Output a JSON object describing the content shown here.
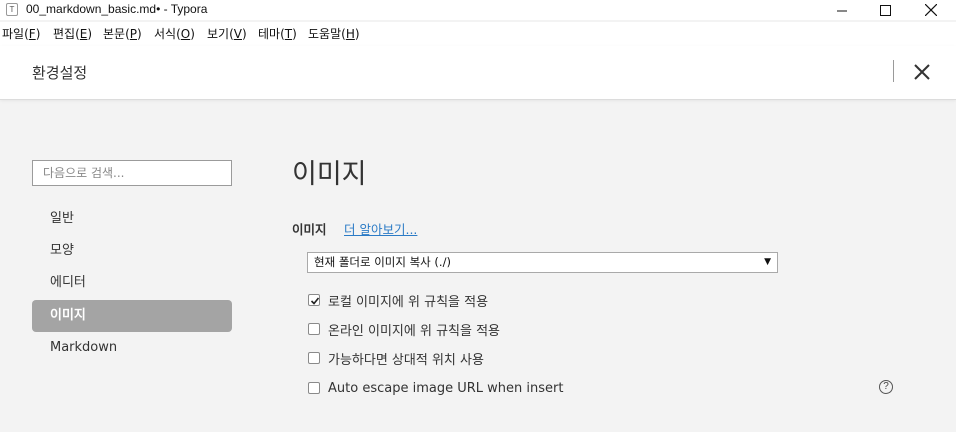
{
  "window": {
    "app_icon_glyph": "T",
    "title": "00_markdown_basic.md• - Typora"
  },
  "menubar": {
    "items": [
      {
        "label": "파일",
        "key": "F"
      },
      {
        "label": "편집",
        "key": "E"
      },
      {
        "label": "본문",
        "key": "P"
      },
      {
        "label": "서식",
        "key": "O"
      },
      {
        "label": "보기",
        "key": "V"
      },
      {
        "label": "테마",
        "key": "T"
      },
      {
        "label": "도움말",
        "key": "H"
      }
    ]
  },
  "preferences": {
    "title": "환경설정",
    "close_icon": "close-icon",
    "search_placeholder": "다음으로 검색...",
    "nav": [
      {
        "label": "일반",
        "active": false
      },
      {
        "label": "모양",
        "active": false
      },
      {
        "label": "에디터",
        "active": false
      },
      {
        "label": "이미지",
        "active": true
      },
      {
        "label": "Markdown",
        "active": false
      }
    ],
    "section": {
      "title": "이미지",
      "subsection_label": "이미지",
      "learn_more": "더 알아보기...",
      "select_value": "현재 폴더로 이미지 복사 (./)",
      "checkboxes": [
        {
          "label": "로컬 이미지에 위 규칙을 적용",
          "checked": true
        },
        {
          "label": "온라인 이미지에 위 규칙을 적용",
          "checked": false
        },
        {
          "label": "가능하다면 상대적 위치 사용",
          "checked": false
        },
        {
          "label": "Auto escape image URL when insert",
          "checked": false
        }
      ],
      "help_glyph": "?"
    }
  },
  "colors": {
    "active_nav_bg": "#a4a4a4",
    "link": "#2b7bc6",
    "panel_bg": "#f3f3f3"
  }
}
